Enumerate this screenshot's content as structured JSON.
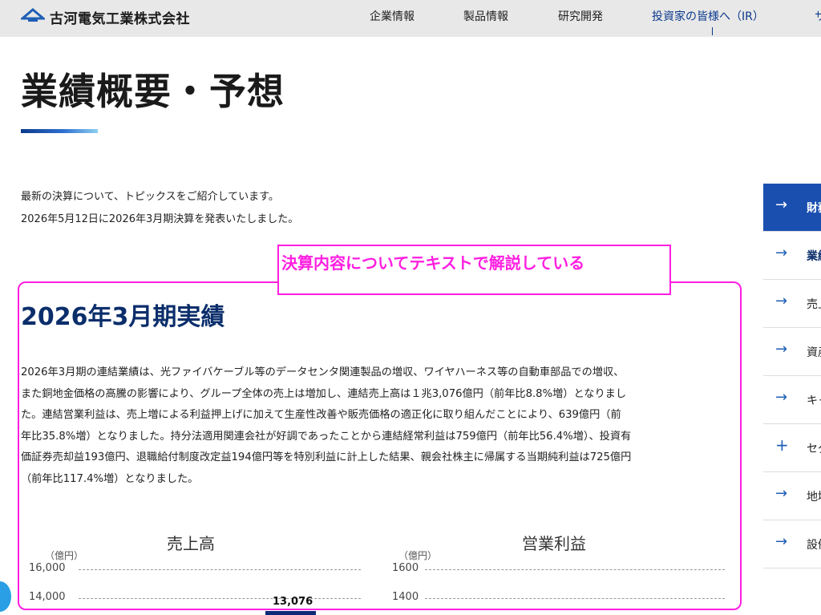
{
  "header": {
    "logo_text": "古河電気工業株式会社",
    "nav": [
      "企業情報",
      "製品情報",
      "研究開発",
      "投資家の皆様へ（IR）"
    ],
    "nav_overflow": "サ"
  },
  "page": {
    "title": "業績概要・予想",
    "intro_line1": "最新の決算について、トピックスをご紹介しています。",
    "intro_line2": "2026年5月12日に2026年3月期決算を発表いたしました。"
  },
  "callout": {
    "label": "決算内容についてテキストで解説している"
  },
  "section": {
    "heading": "2026年3月期実績",
    "paragraph_lines": [
      "2026年3月期の連結業績は、光ファイバケーブル等のデータセンタ関連製品の増収、ワイヤハーネス等の自動車部品での増収、",
      "また銅地金価格の高騰の影響により、グループ全体の売上は増加し、連結売上高は１兆3,076億円（前年比8.8%増）となりまし",
      "た。連結営業利益は、売上増による利益押上げに加えて生産性改善や販売価格の適正化に取り組んだことにより、639億円（前",
      "年比35.8%増）となりました。持分法適用関連会社が好調であったことから連結経常利益は759億円（前年比56.4%増）、投資有",
      "価証券売却益193億円、退職給付制度改定益194億円等を特別利益に計上した結果、親会社株主に帰属する当期純利益は725億円",
      "（前年比117.4%増）となりました。"
    ]
  },
  "chart_data": [
    {
      "type": "bar",
      "title": "売上高",
      "unit": "（億円）",
      "yticks": [
        "16,000",
        "14,000"
      ],
      "visible_data_labels": [
        "13,076"
      ],
      "color": "#0d2a78"
    },
    {
      "type": "bar",
      "title": "営業利益",
      "unit": "（億円）",
      "yticks": [
        "1600",
        "1400"
      ]
    }
  ],
  "sidebar": {
    "items": [
      {
        "label": "財務",
        "icon": "arrow-right-icon"
      },
      {
        "label": "業績",
        "icon": "arrow-right-icon"
      },
      {
        "label": "売上",
        "icon": "arrow-right-icon"
      },
      {
        "label": "資産",
        "icon": "arrow-right-icon"
      },
      {
        "label": "キャ",
        "icon": "arrow-right-icon"
      },
      {
        "label": "セグ",
        "icon": "plus-icon"
      },
      {
        "label": "地域",
        "icon": "arrow-right-icon"
      },
      {
        "label": "設備",
        "icon": "arrow-right-icon"
      }
    ]
  },
  "colors": {
    "accent": "#0b3a8c",
    "highlight": "#ff1fe0",
    "sidebar_active": "#1a4fb0"
  }
}
